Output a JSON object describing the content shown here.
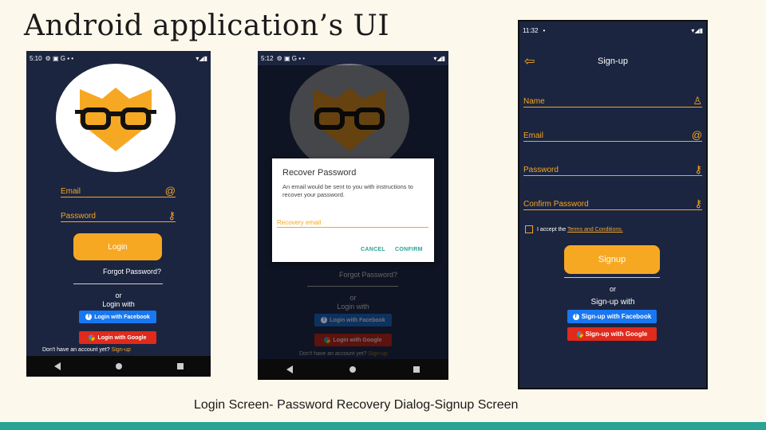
{
  "slide": {
    "title": "Android application’s UI",
    "caption": "Login Screen- Password Recovery  Dialog-Signup Screen"
  },
  "login_screen": {
    "status_time": "5:10",
    "status_icons": "⚙ ▣ G ▪ •",
    "email_label": "Email",
    "password_label": "Password",
    "login_button": "Login",
    "forgot_password": "Forgot Password?",
    "or": "or",
    "login_with": "Login with",
    "facebook_button": "Login with Facebook",
    "google_button": "Login with Google",
    "no_account": "Don't have an account yet?",
    "signup_link": "Sign-up"
  },
  "recovery_screen": {
    "status_time": "5:12",
    "status_icons": "⚙ ▣ G ▪ •",
    "dialog_title": "Recover Password",
    "dialog_message": "An email would be sent to you with instructions to recover your password.",
    "recovery_placeholder": "Recovery email",
    "cancel_button": "CANCEL",
    "confirm_button": "CONFIRM",
    "forgot_password": "Forgot Password?",
    "or": "or",
    "login_with": "Login with",
    "facebook_button": "Login with Facebook",
    "google_button": "Login with Google",
    "no_account": "Don't have an account yet?",
    "signup_link": "Sign-up"
  },
  "signup_screen": {
    "status_time": "11:32",
    "status_dot": "•",
    "title": "Sign-up",
    "name_label": "Name",
    "email_label": "Email",
    "password_label": "Password",
    "confirm_password_label": "Confirm Password",
    "accept_text": "I accept the",
    "terms_link": "Terms and Conditions.",
    "signup_button": "Signup",
    "or": "or",
    "signup_with": "Sign-up with",
    "facebook_button": "Sign-up with Facebook",
    "google_button": "Sign-up with Google"
  },
  "colors": {
    "accent": "#f5a623",
    "phone_bg": "#1b2540",
    "facebook": "#1877f2",
    "google": "#e02a1b",
    "teal": "#2aa394"
  }
}
